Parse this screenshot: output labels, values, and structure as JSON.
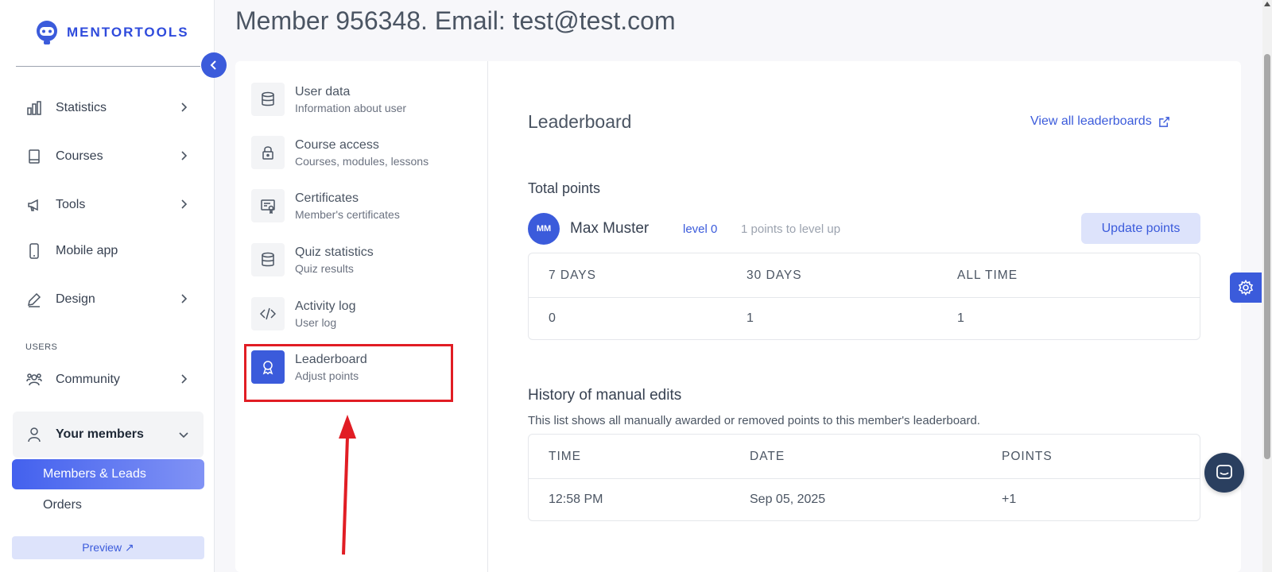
{
  "brand": {
    "name": "MENTORTOOLS",
    "accent": "#3b5bdb"
  },
  "sidebar": {
    "items": [
      {
        "label": "Statistics",
        "icon": "bar-chart-icon"
      },
      {
        "label": "Courses",
        "icon": "book-icon"
      },
      {
        "label": "Tools",
        "icon": "megaphone-icon"
      },
      {
        "label": "Mobile app",
        "icon": "mobile-icon"
      },
      {
        "label": "Design",
        "icon": "pencil-icon"
      }
    ],
    "section_users": "USERS",
    "community": "Community",
    "your_members": "Your members",
    "sub_items": [
      "Members & Leads",
      "Orders"
    ],
    "preview": "Preview ↗"
  },
  "header": {
    "title": "Member 956348. Email: test@test.com"
  },
  "menu": [
    {
      "title": "User data",
      "subtitle": "Information about user",
      "icon": "database-icon"
    },
    {
      "title": "Course access",
      "subtitle": "Courses, modules, lessons",
      "icon": "lock-icon"
    },
    {
      "title": "Certificates",
      "subtitle": "Member's certificates",
      "icon": "certificate-icon"
    },
    {
      "title": "Quiz statistics",
      "subtitle": "Quiz results",
      "icon": "database-icon"
    },
    {
      "title": "Activity log",
      "subtitle": "User log",
      "icon": "code-icon"
    },
    {
      "title": "Leaderboard",
      "subtitle": "Adjust points",
      "icon": "award-icon"
    }
  ],
  "leaderboard": {
    "title": "Leaderboard",
    "view_all": "View all leaderboards",
    "total_points_label": "Total points",
    "member_initials": "MM",
    "member_name": "Max Muster",
    "level": "level 0",
    "to_level_up": "1 points to level up",
    "update_button": "Update points",
    "points_table": {
      "headers": [
        "7 DAYS",
        "30 DAYS",
        "ALL TIME"
      ],
      "values": [
        "0",
        "1",
        "1"
      ]
    },
    "history_title": "History of manual edits",
    "history_desc": "This list shows all manually awarded or removed points to this member's leaderboard.",
    "history_table": {
      "headers": [
        "TIME",
        "DATE",
        "POINTS"
      ],
      "rows": [
        [
          "12:58 PM",
          "Sep 05, 2025",
          "+1"
        ]
      ]
    }
  }
}
